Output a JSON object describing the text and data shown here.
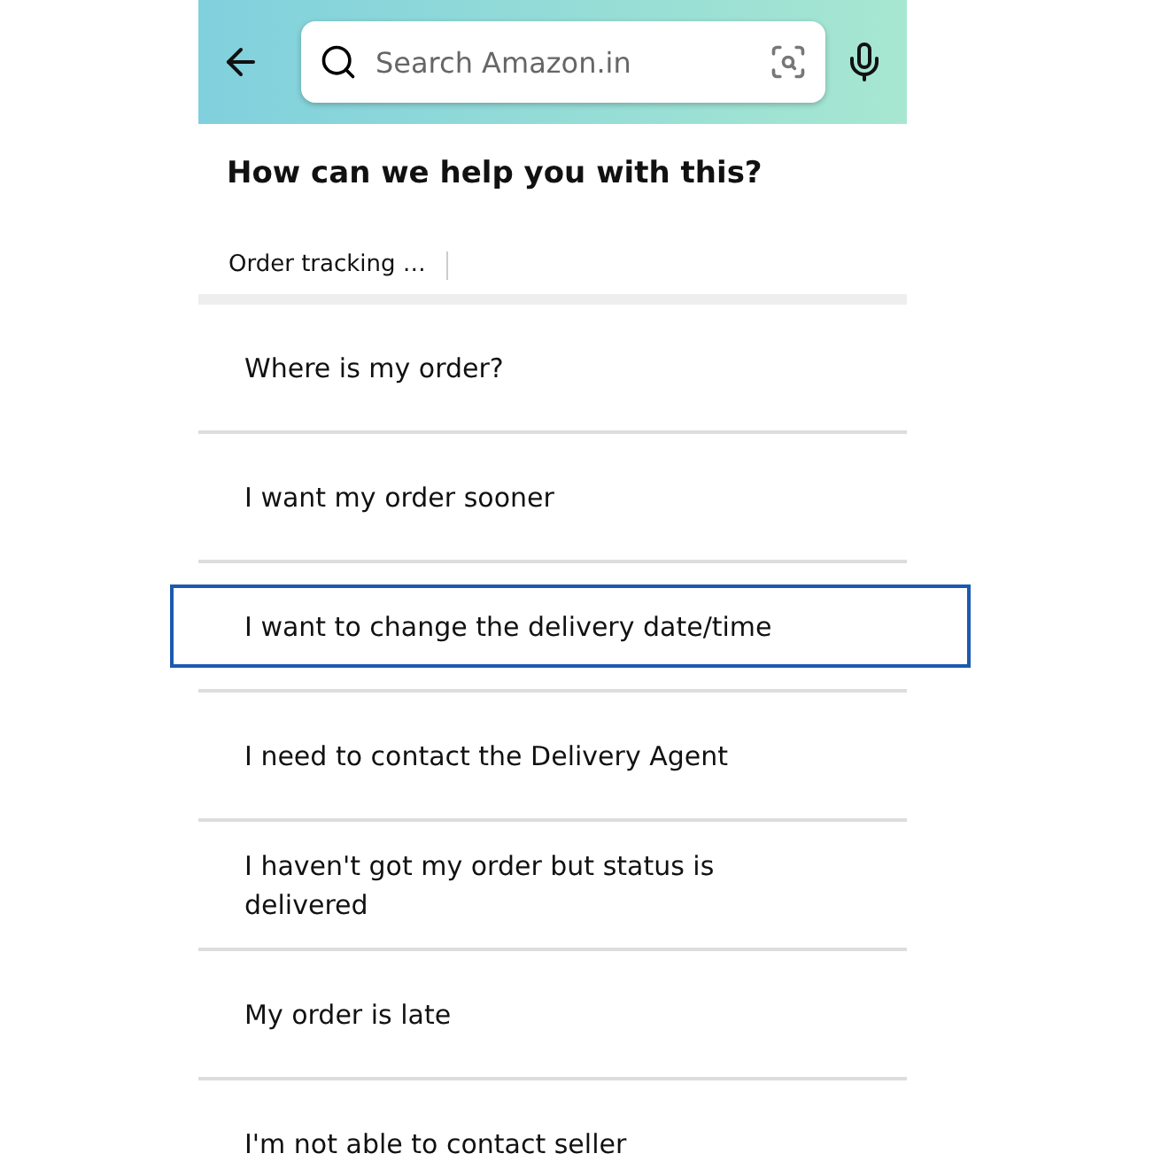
{
  "search": {
    "placeholder": "Search Amazon.in"
  },
  "title": "How can we help you with this?",
  "breadcrumb": "Order tracking …",
  "options": [
    {
      "label": "Where is my order?",
      "selected": false
    },
    {
      "label": "I want my order sooner",
      "selected": false
    },
    {
      "label": "I want to change the delivery date/time",
      "selected": true
    },
    {
      "label": "I need to contact the Delivery Agent",
      "selected": false
    },
    {
      "label": "I haven't got my order but status is delivered",
      "selected": false
    },
    {
      "label": "My order is late",
      "selected": false
    },
    {
      "label": "I'm not able to contact seller",
      "selected": false
    }
  ]
}
